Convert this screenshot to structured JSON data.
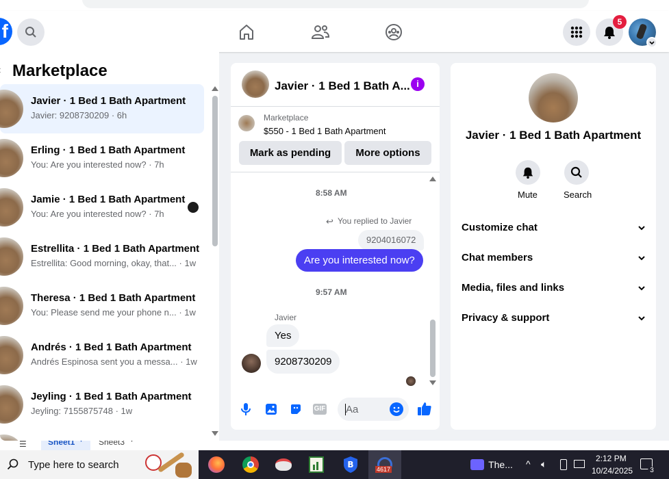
{
  "header": {
    "notif_count": "5"
  },
  "left": {
    "title": "Marketplace",
    "conversations": [
      {
        "title": "Javier · 1 Bed 1 Bath Apartment",
        "snippet": "Javier: 9208730209 · 6h"
      },
      {
        "title": "Erling · 1 Bed 1 Bath Apartment",
        "snippet": "You: Are you interested now? · 7h"
      },
      {
        "title": "Jamie · 1 Bed 1 Bath Apartment",
        "snippet": "You: Are you interested now? · 7h"
      },
      {
        "title": "Estrellita · 1 Bed 1 Bath Apartment",
        "snippet": "Estrellita: Good morning, okay, that... · 1w"
      },
      {
        "title": "Theresa · 1 Bed 1 Bath Apartment",
        "snippet": "You: Please send me your phone n... · 1w"
      },
      {
        "title": "Andrés · 1 Bed 1 Bath Apartment",
        "snippet": "Andrés Espinosa sent you a messa... · 1w"
      },
      {
        "title": "Jeyling · 1 Bed 1 Bath Apartment",
        "snippet": "Jeyling: 7155875748 · 1w"
      }
    ]
  },
  "chat": {
    "title": "Javier · 1 Bed 1 Bath A...",
    "listing_source": "Marketplace",
    "listing": "$550 - 1 Bed 1 Bath Apartment",
    "pending_label": "Mark as pending",
    "more_label": "More options",
    "time1": "8:58 AM",
    "replied": "You replied to Javier",
    "quoted": "9204016072",
    "my_msg": "Are you interested now?",
    "time2": "9:57 AM",
    "sender": "Javier",
    "msg1": "Yes",
    "msg2": "9208730209",
    "input_placeholder": "Aa",
    "gif_label": "GIF"
  },
  "info": {
    "name": "Javier · 1 Bed 1 Bath Apartment",
    "mute": "Mute",
    "search": "Search",
    "sections": [
      "Customize chat",
      "Chat members",
      "Media, files and links",
      "Privacy & support"
    ]
  },
  "sheets": {
    "tab1": "Sheet1",
    "tab2": "Sheet3"
  },
  "taskbar": {
    "search": "Type here to search",
    "badge": "4617",
    "task_label": "The...",
    "time": "2:12 PM",
    "date": "10/24/2025",
    "notif": "3"
  },
  "colors": {
    "accent": "#0866ff",
    "bubble": "#4b3ff2",
    "purple": "#9b00f0",
    "notif": "#e41e3f"
  }
}
